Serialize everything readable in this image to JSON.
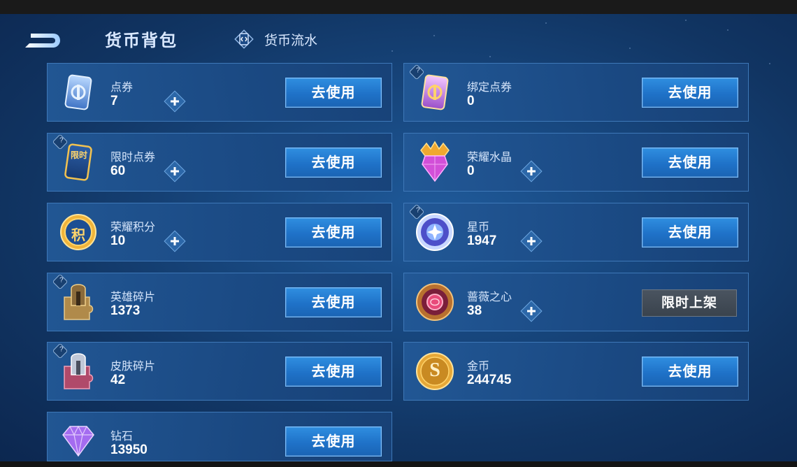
{
  "header": {
    "title": "货币背包",
    "flow_link": "货币流水"
  },
  "items": [
    {
      "name": "点券",
      "amount": "7",
      "action": "去使用",
      "has_plus": true,
      "has_help": false,
      "icon": "coupon-ticket-icon"
    },
    {
      "name": "绑定点券",
      "amount": "0",
      "action": "去使用",
      "has_plus": false,
      "has_help": true,
      "icon": "bound-coupon-ticket-icon"
    },
    {
      "name": "限时点券",
      "amount": "60",
      "action": "去使用",
      "has_plus": true,
      "has_help": true,
      "icon": "limited-coupon-icon",
      "icon_text": "限时"
    },
    {
      "name": "荣耀水晶",
      "amount": "0",
      "action": "去使用",
      "has_plus": true,
      "has_help": false,
      "icon": "glory-crystal-icon"
    },
    {
      "name": "荣耀积分",
      "amount": "10",
      "action": "去使用",
      "has_plus": true,
      "has_help": false,
      "icon": "glory-points-icon",
      "icon_text": "积"
    },
    {
      "name": "星币",
      "amount": "1947",
      "action": "去使用",
      "has_plus": true,
      "has_help": true,
      "icon": "star-coin-icon"
    },
    {
      "name": "英雄碎片",
      "amount": "1373",
      "action": "去使用",
      "has_plus": false,
      "has_help": true,
      "icon": "hero-fragment-icon"
    },
    {
      "name": "蔷薇之心",
      "amount": "38",
      "action": "限时上架",
      "action_style": "limited",
      "has_plus": true,
      "has_help": false,
      "icon": "rose-heart-icon"
    },
    {
      "name": "皮肤碎片",
      "amount": "42",
      "action": "去使用",
      "has_plus": false,
      "has_help": true,
      "icon": "skin-fragment-icon"
    },
    {
      "name": "金币",
      "amount": "244745",
      "action": "去使用",
      "has_plus": false,
      "has_help": false,
      "icon": "gold-coin-icon",
      "icon_text": "S"
    },
    {
      "name": "钻石",
      "amount": "13950",
      "action": "去使用",
      "has_plus": false,
      "has_help": false,
      "icon": "diamond-icon"
    }
  ],
  "colors": {
    "accent_button": "#1f72c8",
    "background": "#17467d",
    "limited_button": "#3a434d"
  }
}
